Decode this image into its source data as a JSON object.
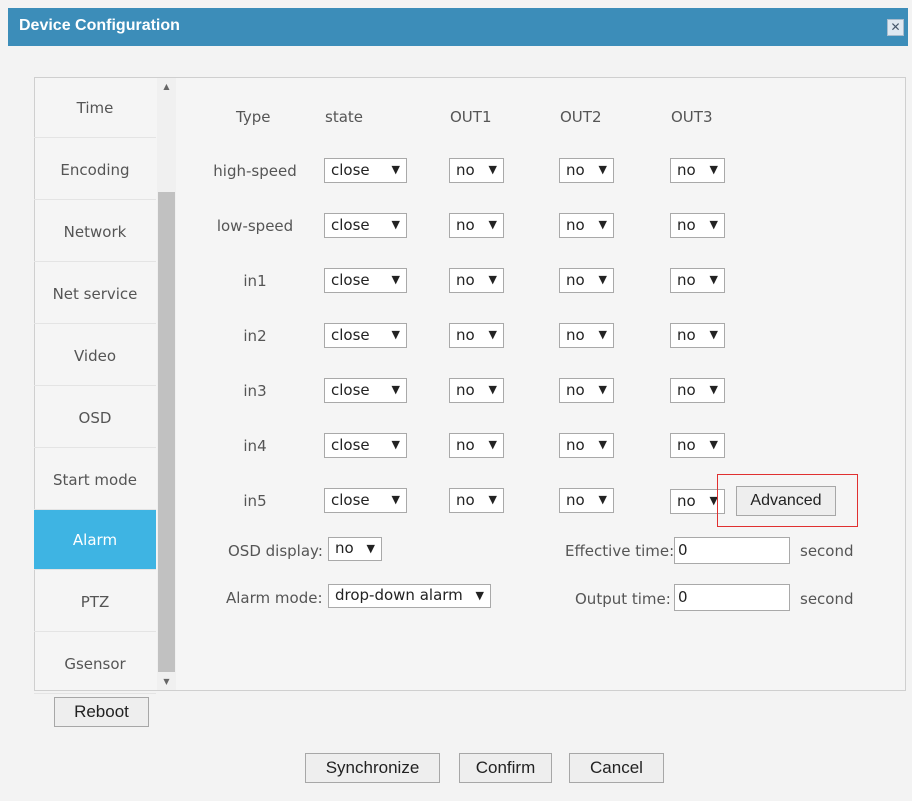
{
  "window": {
    "title": "Device Configuration",
    "close_glyph": "✕"
  },
  "sidebar": {
    "items": [
      {
        "label": "Time"
      },
      {
        "label": "Encoding"
      },
      {
        "label": "Network"
      },
      {
        "label": "Net service"
      },
      {
        "label": "Video"
      },
      {
        "label": "OSD"
      },
      {
        "label": "Start mode"
      },
      {
        "label": "Alarm"
      },
      {
        "label": "PTZ"
      },
      {
        "label": "Gsensor"
      }
    ],
    "active": "Alarm",
    "scroll_up": "▲",
    "scroll_down": "▼"
  },
  "alarm": {
    "headers": {
      "type": "Type",
      "state": "state",
      "out1": "OUT1",
      "out2": "OUT2",
      "out3": "OUT3"
    },
    "rows": [
      {
        "name": "high-speed",
        "state": "close",
        "out1": "no",
        "out2": "no",
        "out3": "no"
      },
      {
        "name": "low-speed",
        "state": "close",
        "out1": "no",
        "out2": "no",
        "out3": "no"
      },
      {
        "name": "in1",
        "state": "close",
        "out1": "no",
        "out2": "no",
        "out3": "no"
      },
      {
        "name": "in2",
        "state": "close",
        "out1": "no",
        "out2": "no",
        "out3": "no"
      },
      {
        "name": "in3",
        "state": "close",
        "out1": "no",
        "out2": "no",
        "out3": "no"
      },
      {
        "name": "in4",
        "state": "close",
        "out1": "no",
        "out2": "no",
        "out3": "no"
      },
      {
        "name": "in5",
        "state": "close",
        "out1": "no",
        "out2": "no",
        "out3": "no"
      }
    ],
    "advanced_label": "Advanced",
    "osd_display": {
      "label": "OSD display:",
      "value": "no"
    },
    "alarm_mode": {
      "label": "Alarm mode:",
      "value": "drop-down alarm"
    },
    "effective_time": {
      "label": "Effective time:",
      "value": "0",
      "unit": "second"
    },
    "output_time": {
      "label": "Output time:",
      "value": "0",
      "unit": "second"
    },
    "dropdown_arrow": "▼"
  },
  "buttons": {
    "reboot": "Reboot",
    "synchronize": "Synchronize",
    "confirm": "Confirm",
    "cancel": "Cancel"
  },
  "colors": {
    "titlebar": "#3c8db9",
    "active_tab": "#3eb4e3",
    "highlight_border": "#e03030"
  }
}
